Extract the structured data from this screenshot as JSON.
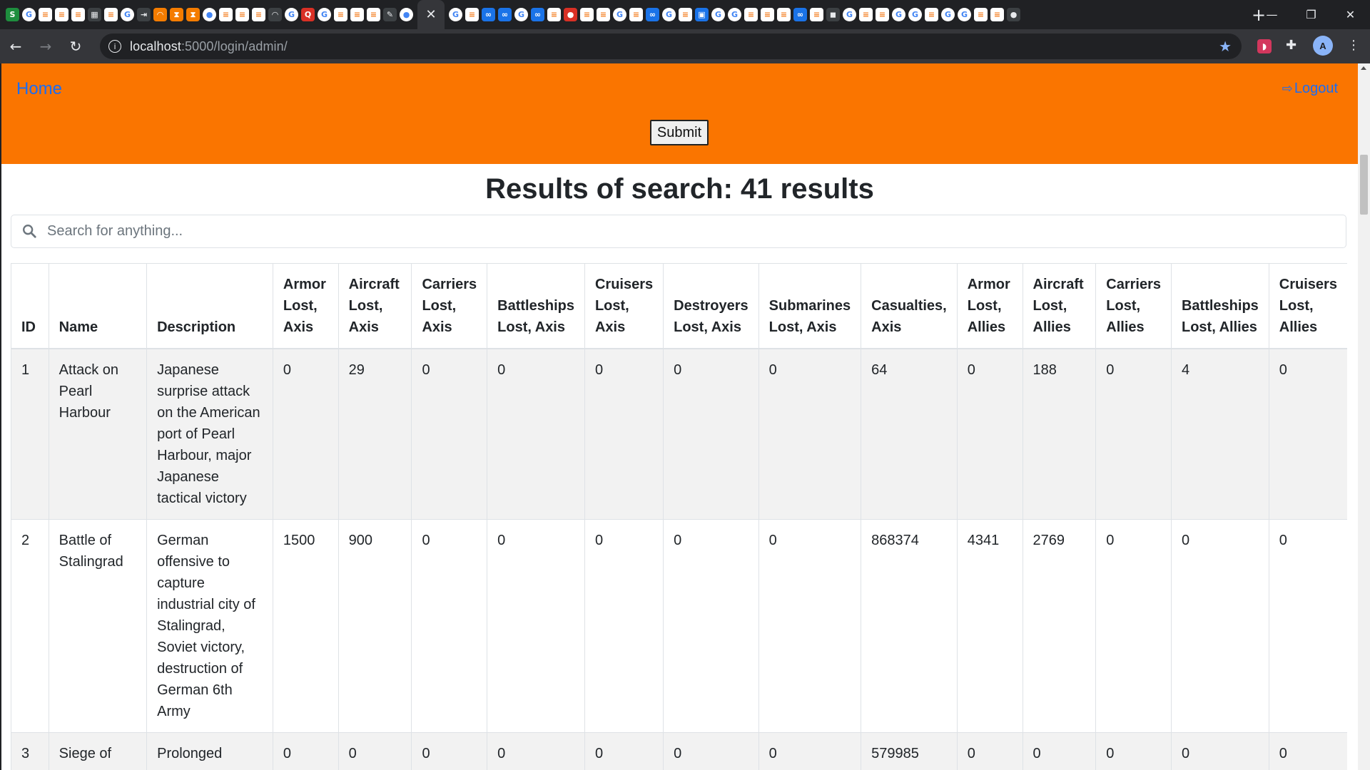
{
  "browser": {
    "tab_close_glyph": "✕",
    "new_tab_glyph": "+",
    "url_host": "localhost",
    "url_rest": ":5000/login/admin/",
    "window_controls": {
      "minimize": "—",
      "maximize": "❐",
      "close": "✕"
    },
    "avatar_letter": "A"
  },
  "navbar": {
    "home_label": "Home",
    "logout_label": "Logout",
    "submit_label": "Submit",
    "background_color": "#fa7500",
    "link_color": "#1a6df5"
  },
  "results": {
    "title": "Results of search: 41 results"
  },
  "search": {
    "placeholder": "Search for anything..."
  },
  "table": {
    "headers": [
      "ID",
      "Name",
      "Description",
      "Armor Lost, Axis",
      "Aircraft Lost, Axis",
      "Carriers Lost, Axis",
      "Battleships Lost, Axis",
      "Cruisers Lost, Axis",
      "Destroyers Lost, Axis",
      "Submarines Lost, Axis",
      "Casualties, Axis",
      "Armor Lost, Allies",
      "Aircraft Lost, Allies",
      "Carriers Lost, Allies",
      "Battleships Lost, Allies",
      "Cruisers Lost, Allies"
    ],
    "rows": [
      [
        "1",
        "Attack on Pearl Harbour",
        "Japanese surprise attack on the American port of Pearl Harbour, major Japanese tactical victory",
        "0",
        "29",
        "0",
        "0",
        "0",
        "0",
        "0",
        "64",
        "0",
        "188",
        "0",
        "4",
        "0"
      ],
      [
        "2",
        "Battle of Stalingrad",
        "German offensive to capture industrial city of Stalingrad, Soviet victory, destruction of German 6th Army",
        "1500",
        "900",
        "0",
        "0",
        "0",
        "0",
        "0",
        "868374",
        "4341",
        "2769",
        "0",
        "0",
        "0"
      ],
      [
        "3",
        "Siege of",
        "Prolonged",
        "0",
        "0",
        "0",
        "0",
        "0",
        "0",
        "0",
        "579985",
        "0",
        "0",
        "0",
        "0",
        "0"
      ]
    ]
  }
}
